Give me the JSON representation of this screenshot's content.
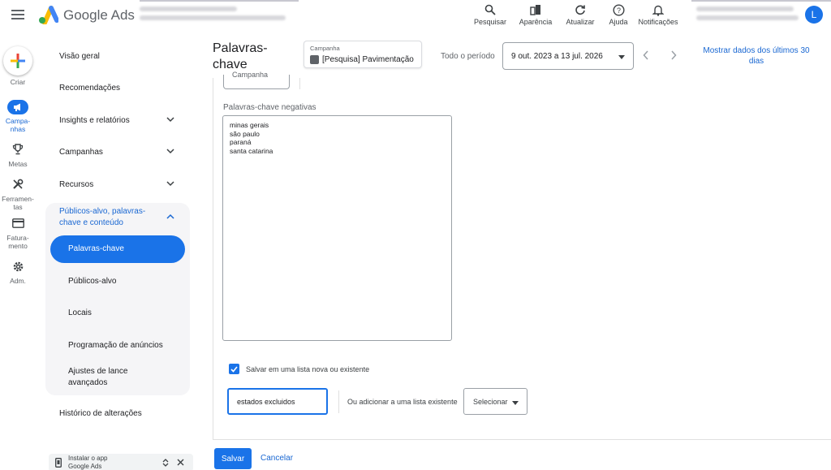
{
  "header": {
    "brand": "Google Ads",
    "actions": [
      {
        "label": "Pesquisar",
        "icon": "search-icon"
      },
      {
        "label": "Aparência",
        "icon": "appearance-icon"
      },
      {
        "label": "Atualizar",
        "icon": "refresh-icon"
      },
      {
        "label": "Ajuda",
        "icon": "help-icon"
      },
      {
        "label": "Notificações",
        "icon": "bell-icon"
      }
    ],
    "avatar_initial": "L"
  },
  "rail": {
    "create": "Criar",
    "items": [
      {
        "label": "Campa-\nnhas",
        "icon": "megaphone-icon",
        "active": true
      },
      {
        "label": "Metas",
        "icon": "trophy-icon",
        "active": false
      },
      {
        "label": "Ferramen-\ntas",
        "icon": "tools-icon",
        "active": false
      },
      {
        "label": "Fatura-\nmento",
        "icon": "credit-card-icon",
        "active": false
      },
      {
        "label": "Adm.",
        "icon": "gear-icon",
        "active": false
      }
    ]
  },
  "sidenav": {
    "items": [
      "Visão geral",
      "Recomendações",
      "Insights e relatórios",
      "Campanhas",
      "Recursos"
    ],
    "group_title": "Públicos-alvo, palavras-chave e conteúdo",
    "active_item": "Palavras-chave",
    "sub_items": [
      "Públicos-alvo",
      "Locais",
      "Programação de anúncios",
      "Ajustes de lance avançados"
    ],
    "history": "Histórico de alterações",
    "install_app": "Instalar o app Google Ads"
  },
  "main": {
    "title": "Palavras-chave",
    "campaign_label": "Campanha",
    "campaign_value": "[Pesquisa] Pavimentação",
    "period_label": "Todo o período",
    "date_range": "9 out. 2023 a 13 jul. 2026",
    "show_last_30": "Mostrar dados dos últimos 30 dias",
    "partial_select": "Campanha",
    "negative_label": "Palavras-chave negativas",
    "negative_keywords": [
      "minas gerais",
      "são paulo",
      "paraná",
      "santa catarina"
    ],
    "save_list_label": "Salvar em uma lista nova ou existente",
    "save_list_checked": true,
    "list_name": "estados excluidos",
    "or_add_label": "Ou adicionar a uma lista existente",
    "select_label": "Selecionar",
    "save": "Salvar",
    "cancel": "Cancelar"
  },
  "colors": {
    "accent": "#1a73e8",
    "link": "#1967d2"
  }
}
